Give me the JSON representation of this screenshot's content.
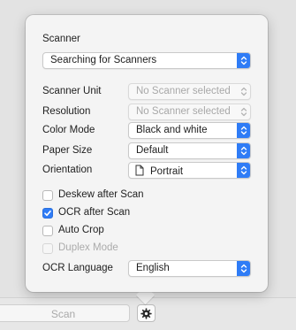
{
  "scanner_section": {
    "title": "Scanner",
    "scanner_popup": "Searching for Scanners"
  },
  "settings": {
    "scanner_unit": {
      "label": "Scanner Unit",
      "value": "No Scanner selected"
    },
    "resolution": {
      "label": "Resolution",
      "value": "No Scanner selected"
    },
    "color_mode": {
      "label": "Color Mode",
      "value": "Black and white"
    },
    "paper_size": {
      "label": "Paper Size",
      "value": "Default"
    },
    "orientation": {
      "label": "Orientation",
      "value": "Portrait",
      "icon": "portrait-page-icon"
    }
  },
  "options": {
    "deskew": {
      "label": "Deskew after Scan",
      "checked": false,
      "enabled": true
    },
    "ocr": {
      "label": "OCR after Scan",
      "checked": true,
      "enabled": true
    },
    "auto_crop": {
      "label": "Auto Crop",
      "checked": false,
      "enabled": true
    },
    "duplex": {
      "label": "Duplex Mode",
      "checked": false,
      "enabled": false
    }
  },
  "ocr_language": {
    "label": "OCR Language",
    "value": "English"
  },
  "toolbar": {
    "scan_label": "Scan",
    "settings_icon": "gear-icon"
  },
  "colors": {
    "accent": "#2f7cf6",
    "popover_bg": "#f4f4f4",
    "disabled_text": "#a8a8a8"
  }
}
